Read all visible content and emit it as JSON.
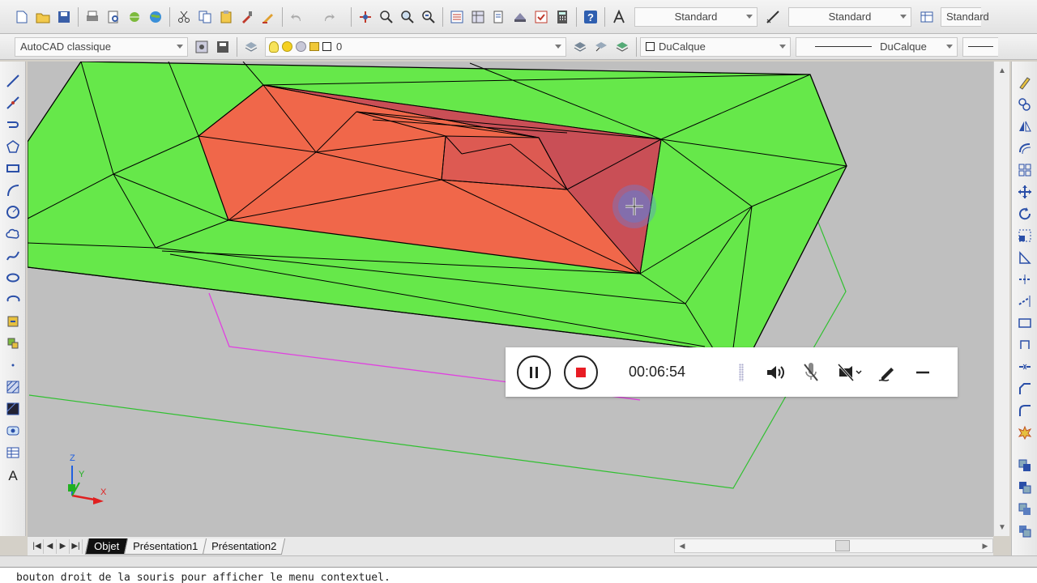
{
  "toolbar1": {
    "text_style_value": "Standard",
    "dim_style_value": "Standard",
    "table_style_value": "Standard"
  },
  "toolbar2": {
    "workspace_value": "AutoCAD classique",
    "layer_value": "0",
    "color_value": "DuCalque",
    "linetype_value": "DuCalque"
  },
  "tabs": [
    {
      "label": "Objet",
      "active": true
    },
    {
      "label": "Présentation1",
      "active": false
    },
    {
      "label": "Présentation2",
      "active": false
    }
  ],
  "command_line": {
    "text": "bouton droit de la souris pour afficher le menu contextuel."
  },
  "recorder": {
    "timer": "00:06:54",
    "stop_color": "#e81c24"
  },
  "ucs": {
    "z_label": "Z",
    "y_label": "Y",
    "x_label": "X"
  },
  "colors": {
    "terrain_green": "#66e84a",
    "terrain_orange": "#f0674a",
    "terrain_red": "#c94f56",
    "magenta_outline": "#e040e0",
    "green_outline": "#30c030",
    "viewport_bg": "#bfbfbf"
  }
}
